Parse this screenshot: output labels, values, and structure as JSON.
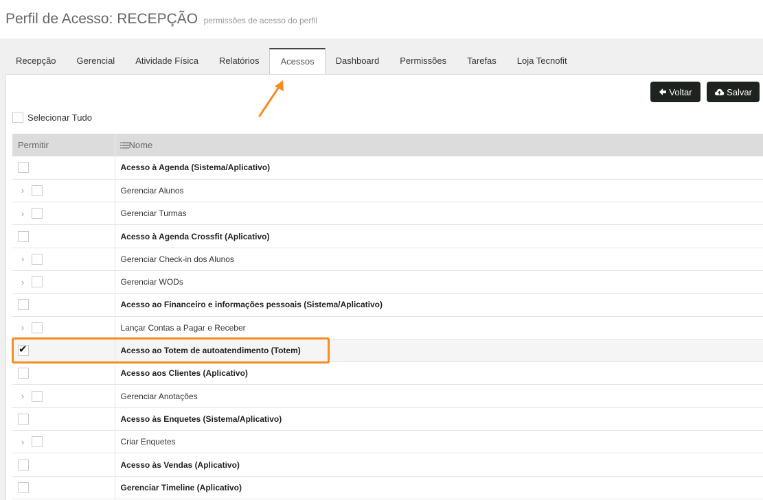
{
  "header": {
    "title": "Perfil de Acesso: RECEPÇÃO",
    "subtitle": "permissões de acesso do perfil"
  },
  "tabs": [
    {
      "label": "Recepção",
      "active": false
    },
    {
      "label": "Gerencial",
      "active": false
    },
    {
      "label": "Atividade Física",
      "active": false
    },
    {
      "label": "Relatórios",
      "active": false
    },
    {
      "label": "Acessos",
      "active": true
    },
    {
      "label": "Dashboard",
      "active": false
    },
    {
      "label": "Permissões",
      "active": false
    },
    {
      "label": "Tarefas",
      "active": false
    },
    {
      "label": "Loja Tecnofit",
      "active": false
    }
  ],
  "toolbar": {
    "voltar_label": "Voltar",
    "salvar_label": "Salvar"
  },
  "select_all": {
    "label": "Selecionar Tudo",
    "checked": false
  },
  "table": {
    "headers": {
      "permitir": "Permitir",
      "nome": "Nome"
    },
    "rows": [
      {
        "label": "Acesso à Agenda (Sistema/Aplicativo)",
        "parent": true,
        "checked": false
      },
      {
        "label": "Gerenciar Alunos",
        "parent": false,
        "checked": false
      },
      {
        "label": "Gerenciar Turmas",
        "parent": false,
        "checked": false
      },
      {
        "label": "Acesso à Agenda Crossfit (Aplicativo)",
        "parent": true,
        "checked": false
      },
      {
        "label": "Gerenciar Check-in dos Alunos",
        "parent": false,
        "checked": false
      },
      {
        "label": "Gerenciar WODs",
        "parent": false,
        "checked": false
      },
      {
        "label": "Acesso ao Financeiro e informações pessoais (Sistema/Aplicativo)",
        "parent": true,
        "checked": false
      },
      {
        "label": "Lançar Contas a Pagar e Receber",
        "parent": false,
        "checked": false
      },
      {
        "label": "Acesso ao Totem de autoatendimento (Totem)",
        "parent": true,
        "checked": true
      },
      {
        "label": "Acesso aos Clientes (Aplicativo)",
        "parent": true,
        "checked": false
      },
      {
        "label": "Gerenciar Anotações",
        "parent": false,
        "checked": false
      },
      {
        "label": "Acesso às Enquetes (Sistema/Aplicativo)",
        "parent": true,
        "checked": false
      },
      {
        "label": "Criar Enquetes",
        "parent": false,
        "checked": false
      },
      {
        "label": "Acesso às Vendas (Aplicativo)",
        "parent": true,
        "checked": false
      },
      {
        "label": "Gerenciar Timeline (Aplicativo)",
        "parent": true,
        "checked": false
      }
    ]
  },
  "colors": {
    "accent_orange": "#f68b1f",
    "button_dark": "#1e2320",
    "header_gray": "#dcdcdc"
  },
  "icons": {
    "voltar": "arrow-left-icon",
    "salvar": "cloud-upload-icon",
    "nome_header": "list-icon",
    "expand": "chevron-right-icon"
  }
}
